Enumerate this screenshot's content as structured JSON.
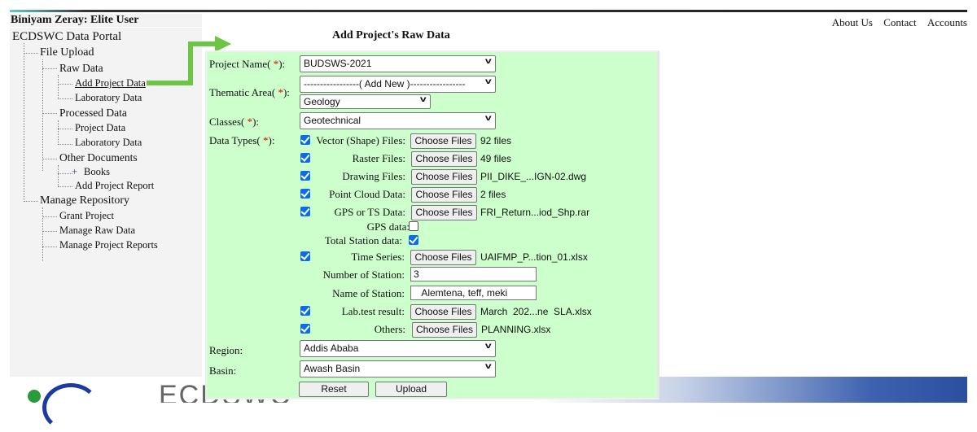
{
  "user": "Biniyam Zeray: Elite User",
  "tree": {
    "root": "ECDSWC Data Portal",
    "file_upload": "File Upload",
    "raw_data": "Raw Data",
    "add_project_data": "Add Project Data",
    "laboratory_data": "Laboratory Data",
    "processed_data": "Processed Data",
    "project_data": "Project Data",
    "laboratory_data_2": "Laboratory Data",
    "other_documents": "Other Documents",
    "books": "Books",
    "add_project_report": "Add Project Report",
    "manage_repository": "Manage Repository",
    "grant_project": "Grant Project",
    "manage_raw_data": "Manage Raw Data",
    "manage_project_reports": "Manage Project Reports"
  },
  "top_links": [
    "About Us",
    "Contact",
    "Accounts"
  ],
  "page_title": "Add Project's Raw Data",
  "form": {
    "project_name_label": "Project Name(",
    "thematic_area_label": "Thematic Area(",
    "classes_label": "Classes(",
    "data_types_label": "Data Types(",
    "required_mark": "*",
    "label_close": "):",
    "project_name": "BUDSWS-2021",
    "thematic_area": "-----------------( Add New )-----------------",
    "thematic_sub": "Geology",
    "classes": "Geotechnical",
    "choose_files": "Choose Files",
    "file_rows": [
      {
        "label": "Vector (Shape) Files:",
        "checked": true,
        "file": "92 files"
      },
      {
        "label": "Raster Files:",
        "checked": true,
        "file": "49 files"
      },
      {
        "label": "Drawing Files:",
        "checked": true,
        "file": "PII_DIKE_...IGN-02.dwg"
      },
      {
        "label": "Point Cloud Data:",
        "checked": true,
        "file": "2 files"
      },
      {
        "label": "GPS or TS Data:",
        "checked": true,
        "file": "FRI_Return...iod_Shp.rar"
      }
    ],
    "gps_data_label": "GPS data:",
    "gps_data_checked": false,
    "total_station_label": "Total Station data:",
    "total_station_checked": true,
    "time_series": {
      "label": "Time Series:",
      "checked": true,
      "file": "UAIFMP_P...tion_01.xlsx"
    },
    "number_of_station_label": "Number of Station:",
    "number_of_station": "3",
    "name_of_station_label": "Name of Station:",
    "name_of_station": "   Alemtena, teff, meki",
    "lab_test": {
      "label": "Lab.test result:",
      "checked": true,
      "file": "March  202...ne  SLA.xlsx"
    },
    "others": {
      "label": "Others:",
      "checked": true,
      "file": "PLANNING.xlsx"
    },
    "region_label": "Region:",
    "region": "Addis Ababa",
    "basin_label": "Basin:",
    "basin": "Awash Basin",
    "reset": "Reset",
    "upload": "Upload"
  },
  "banner_text": "ECDSWC",
  "colors": {
    "panel_bg": "#ccffcc",
    "arrow": "#6cc644",
    "checkbox": "#0b6ce8",
    "required": "#e00000"
  }
}
